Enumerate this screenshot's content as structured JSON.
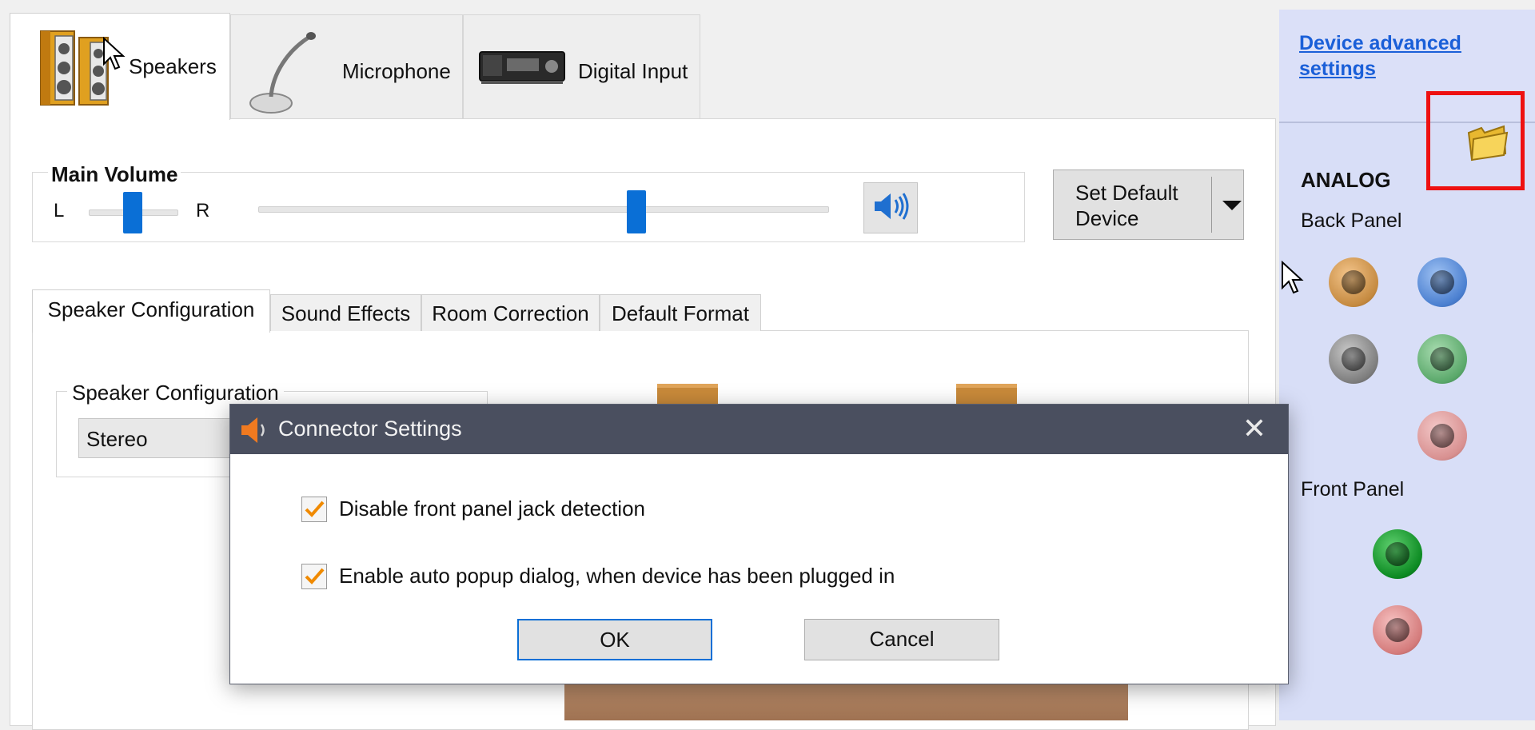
{
  "device_tabs": [
    {
      "label": "Speakers",
      "active": true,
      "icon": "speakers-icon"
    },
    {
      "label": "Microphone",
      "active": false,
      "icon": "microphone-icon"
    },
    {
      "label": "Digital Input",
      "active": false,
      "icon": "digital-input-icon"
    }
  ],
  "volume": {
    "title": "Main Volume",
    "left_label": "L",
    "right_label": "R",
    "balance_level": 0.5,
    "volume_level": 0.66
  },
  "set_default": {
    "label": "Set Default Device"
  },
  "inner_tabs": [
    {
      "label": "Speaker Configuration",
      "active": true
    },
    {
      "label": "Sound Effects",
      "active": false
    },
    {
      "label": "Room Correction",
      "active": false
    },
    {
      "label": "Default Format",
      "active": false
    }
  ],
  "speaker_config": {
    "group_title": "Speaker Configuration",
    "selected": "Stereo"
  },
  "right_panel": {
    "advanced_link": "Device advanced settings",
    "analog_title": "ANALOG",
    "back_panel_label": "Back Panel",
    "front_panel_label": "Front Panel",
    "back_jacks": [
      "orange",
      "blue",
      "gray",
      "green",
      "pink"
    ],
    "front_jacks": [
      "green",
      "pink"
    ],
    "folder_icon": "folder-icon",
    "highlight_color": "#ee1111"
  },
  "dialog": {
    "title": "Connector Settings",
    "close_glyph": "✕",
    "options": [
      {
        "label": "Disable front panel jack detection",
        "checked": true
      },
      {
        "label": "Enable auto popup dialog, when device has been plugged in",
        "checked": true
      }
    ],
    "ok_label": "OK",
    "cancel_label": "Cancel"
  },
  "colors": {
    "accent": "#0a6fd6",
    "checkmark": "#f08a00",
    "titlebar": "#4a4f5f",
    "link": "#1a5fd8"
  }
}
